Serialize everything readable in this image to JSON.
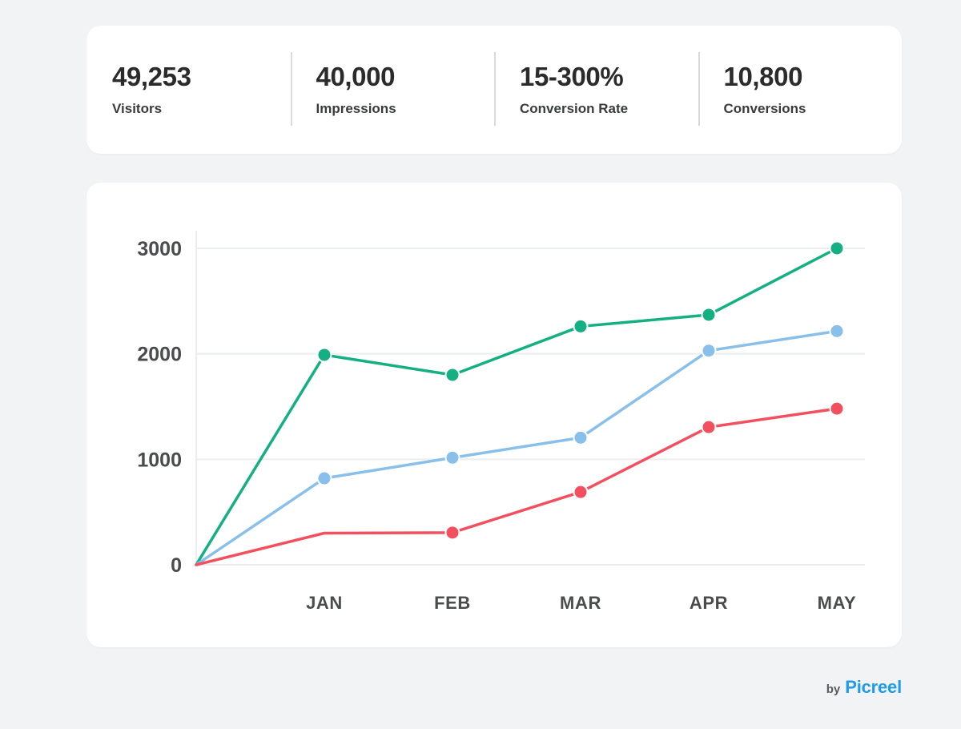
{
  "stats": {
    "items": [
      {
        "value": "49,253",
        "label": "Visitors"
      },
      {
        "value": "40,000",
        "label": "Impressions"
      },
      {
        "value": "15-300%",
        "label": "Conversion Rate"
      },
      {
        "value": "10,800",
        "label": "Conversions"
      }
    ]
  },
  "branding": {
    "by_label": "by",
    "name": "Picreel",
    "color": "#1f9be8"
  },
  "chart_data": {
    "type": "line",
    "title": "",
    "xlabel": "",
    "ylabel": "",
    "categories": [
      "",
      "JAN",
      "FEB",
      "MAR",
      "APR",
      "MAY"
    ],
    "tick_labels": [
      "JAN",
      "FEB",
      "MAR",
      "APR",
      "MAY"
    ],
    "y_ticks": [
      0,
      1000,
      2000,
      3000
    ],
    "y_tick_labels": [
      "0",
      "1000",
      "2000",
      "3000"
    ],
    "ylim": [
      0,
      3000
    ],
    "grid": true,
    "legend": "none",
    "series": [
      {
        "name": "green-series",
        "color": "#14b083",
        "values": [
          0,
          1990,
          1800,
          2260,
          2370,
          3000
        ],
        "markers": [
          false,
          true,
          true,
          true,
          true,
          true
        ]
      },
      {
        "name": "blue-series",
        "color": "#89bfeb",
        "values": [
          0,
          820,
          1015,
          1205,
          2030,
          2215
        ],
        "markers": [
          false,
          true,
          true,
          true,
          true,
          true
        ]
      },
      {
        "name": "red-series",
        "color": "#f2505f",
        "values": [
          0,
          300,
          305,
          690,
          1305,
          1480
        ],
        "markers": [
          false,
          false,
          true,
          true,
          true,
          true
        ]
      }
    ]
  }
}
